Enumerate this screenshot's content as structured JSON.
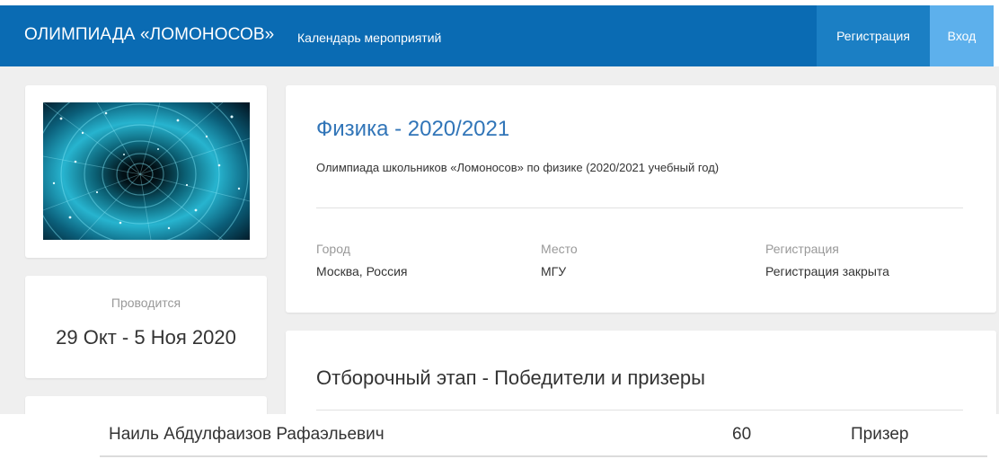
{
  "navbar": {
    "brand": "ОЛИМПИАДА «ЛОМОНОСОВ»",
    "calendar_link": "Календарь мероприятий",
    "register_button": "Регистрация",
    "login_button": "Вход",
    "bg_color": "#0a6bb3",
    "register_color": "#1b7fc4",
    "login_color": "#5db0ec"
  },
  "sidebar": {
    "dates_label": "Проводится",
    "dates_value": "29 Окт - 5 Ноя 2020"
  },
  "event": {
    "title": "Физика - 2020/2021",
    "description": "Олимпиада школьников «Ломоносов» по физике (2020/2021 учебный год)",
    "meta": [
      {
        "label": "Город",
        "value": "Москва, Россия"
      },
      {
        "label": "Место",
        "value": "МГУ"
      },
      {
        "label": "Регистрация",
        "value": "Регистрация закрыта"
      }
    ],
    "title_color": "#3175b8"
  },
  "results": {
    "heading": "Отборочный этап - Победители и призеры",
    "rows": [
      {
        "name": "Наиль Абдулфаизов Рафаэльевич",
        "score": "60",
        "status": "Призер"
      }
    ]
  }
}
